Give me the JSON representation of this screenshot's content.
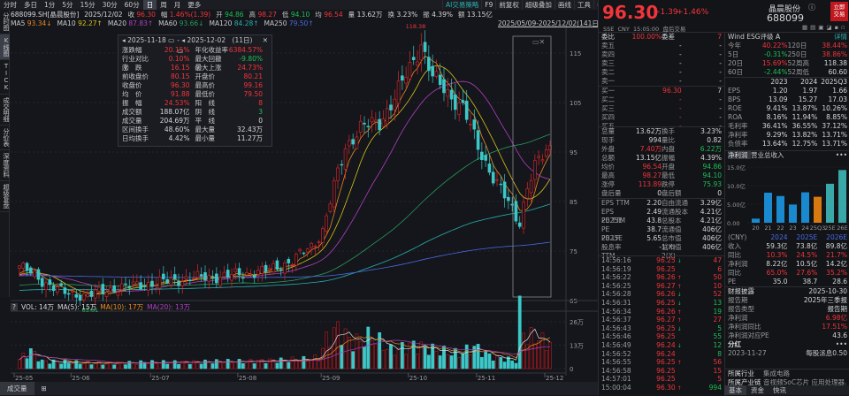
{
  "toolbar": {
    "tabs": [
      "分时",
      "多日",
      "1分",
      "5分",
      "15分",
      "30分",
      "60分",
      "日",
      "周",
      "月",
      "更多"
    ],
    "active": "日",
    "right": [
      "AI交易策略",
      "F9",
      "前复权",
      "超级叠加",
      "画线",
      "工具",
      "⚙",
      "?",
      "»"
    ]
  },
  "sidebar": [
    "分时图",
    "K线图",
    "TICK",
    "成交明细",
    "分价表",
    "深度资料",
    "超级复盘"
  ],
  "sidebar_active": "K线图",
  "info": {
    "code": "688099.SH[晶晨股份]",
    "date": "2025/12/02",
    "close_l": "收",
    "close": "96.30",
    "chg_l": "幅",
    "chg": "1.46%(1.39)",
    "open_l": "开",
    "open": "94.86",
    "high_l": "高",
    "high": "98.27",
    "low_l": "低",
    "low": "94.10",
    "avg_l": "均",
    "avg": "96.54",
    "vol_l": "量",
    "vol": "13.62万",
    "turn_l": "换",
    "turn": "3.23%",
    "amp_l": "振",
    "amp": "4.39%",
    "amt_l": "额",
    "amt": "13.15亿"
  },
  "ma": {
    "ma5": "MA5",
    "ma5v": "93.34↓",
    "ma10": "MA10",
    "ma10v": "92.27↑",
    "ma20": "MA20",
    "ma20v": "87.83↑",
    "ma60": "MA60",
    "ma60v": "93.66↓",
    "ma120": "MA120",
    "ma120v": "84.28↑",
    "ma250": "MA250",
    "ma250v": "79.50↑"
  },
  "range_label": "2025/05/09-2025/12/02(141日)",
  "popup": {
    "from": "2025-11-18",
    "to": "2025-12-02",
    "days": "(11日)",
    "rows": [
      [
        "涨跌幅",
        "20.15%",
        "r",
        "年化收益率",
        "6384.57%",
        "r"
      ],
      [
        "行业对比 ⓘ",
        "0.10%",
        "r",
        "最大回撤 ⓘ",
        "-9.80%",
        "g"
      ],
      [
        "涨　跌",
        "16.15",
        "r",
        "最大上涨",
        "24.73%",
        "r"
      ],
      [
        "前收盘价",
        "80.15",
        "r",
        "开盘价",
        "80.21",
        "r"
      ],
      [
        "收盘价",
        "96.30",
        "r",
        "最高价",
        "99.16",
        "r"
      ],
      [
        "均　价",
        "91.88",
        "r",
        "最低价",
        "79.50",
        "r"
      ],
      [
        "振　幅",
        "24.53%",
        "r",
        "阳　线",
        "8",
        "r"
      ],
      [
        "成交额",
        "188.07亿",
        "w",
        "阴　线",
        "3",
        "g"
      ],
      [
        "成交量",
        "204.69万",
        "w",
        "平　线",
        "0",
        "w"
      ],
      [
        "区间换手",
        "48.60%",
        "w",
        "最大量",
        "32.43万",
        "w"
      ],
      [
        "日均换手",
        "4.42%",
        "w",
        "最小量",
        "11.27万",
        "w"
      ]
    ]
  },
  "chart_data": {
    "type": "candlestick",
    "days": 141,
    "yticks": [
      "115",
      "105",
      "95",
      "85",
      "75",
      "65"
    ],
    "xticks": [
      "25-05",
      "25-06",
      "25-07",
      "25-08",
      "25-09",
      "25-10",
      "25-11",
      "25-12"
    ],
    "max_label": "118.38",
    "min_label": "65.61",
    "close_anchors": [
      [
        0,
        72
      ],
      [
        6,
        69
      ],
      [
        12,
        66.5
      ],
      [
        18,
        66
      ],
      [
        25,
        67.5
      ],
      [
        35,
        68.5
      ],
      [
        45,
        69.5
      ],
      [
        55,
        70
      ],
      [
        65,
        71
      ],
      [
        72,
        73
      ],
      [
        77,
        76
      ],
      [
        80,
        79
      ],
      [
        83,
        88
      ],
      [
        86,
        96
      ],
      [
        90,
        100
      ],
      [
        95,
        101
      ],
      [
        99,
        106
      ],
      [
        103,
        112
      ],
      [
        106,
        117
      ],
      [
        109,
        110
      ],
      [
        113,
        107
      ],
      [
        117,
        104
      ],
      [
        121,
        96
      ],
      [
        125,
        90
      ],
      [
        128,
        86
      ],
      [
        131,
        82
      ],
      [
        132,
        81
      ],
      [
        134,
        88
      ],
      [
        136,
        92
      ],
      [
        138,
        94
      ],
      [
        140,
        96.3
      ]
    ],
    "volume_anchors": [
      [
        0,
        5
      ],
      [
        3,
        10
      ],
      [
        6,
        4
      ],
      [
        20,
        3
      ],
      [
        40,
        3.5
      ],
      [
        60,
        4
      ],
      [
        75,
        5
      ],
      [
        79,
        6
      ],
      [
        81,
        16
      ],
      [
        84,
        22
      ],
      [
        88,
        14
      ],
      [
        93,
        18
      ],
      [
        98,
        10
      ],
      [
        104,
        13
      ],
      [
        110,
        10
      ],
      [
        116,
        8
      ],
      [
        120,
        12
      ],
      [
        124,
        7
      ],
      [
        129,
        5
      ],
      [
        131,
        4
      ],
      [
        132,
        30
      ],
      [
        134,
        16
      ],
      [
        136,
        18
      ],
      [
        138,
        15
      ],
      [
        140,
        14
      ]
    ],
    "vol_yticks": [
      "26万",
      "13万",
      "0"
    ]
  },
  "vol": {
    "help": "?",
    "vol": "VOL: 14万",
    "ma5": "MA(5): 15万",
    "ma10": "MA(10): 17万",
    "ma20": "MA(20): 13万"
  },
  "bottom_tabs": [
    "成交量",
    "⊞"
  ],
  "quote": {
    "price": "96.30",
    "chg": "+1.39",
    "pct": "+1.46%",
    "name": "晶晨股份",
    "code": "688099",
    "trade_btn": "立即\n交易",
    "meta": "SSE  CNY  15:05:00  盘后交易"
  },
  "book": {
    "ratio_l": "委比",
    "ratio": "100.00%",
    "diff_l": "委差",
    "diff": "7",
    "asks": [
      [
        "卖五",
        "-",
        "-"
      ],
      [
        "卖四",
        "-",
        "-"
      ],
      [
        "卖三",
        "-",
        "-"
      ],
      [
        "卖二",
        "-",
        "-"
      ],
      [
        "卖一",
        "-",
        "-"
      ]
    ],
    "bids": [
      [
        "买一",
        "96.30",
        "7"
      ],
      [
        "买二",
        "-",
        "-"
      ],
      [
        "买三",
        "-",
        "-"
      ],
      [
        "买四",
        "-",
        "-"
      ],
      [
        "买五",
        "-",
        "-"
      ]
    ]
  },
  "stats": [
    [
      "总量",
      "13.62万",
      "w",
      "换手",
      "3.23%",
      "w"
    ],
    [
      "现手",
      "994",
      "w",
      "量比",
      "0.82",
      "w"
    ],
    [
      "外盘",
      "7.40万",
      "r",
      "内盘",
      "6.22万",
      "g"
    ],
    [
      "总额",
      "13.15亿",
      "w",
      "振幅",
      "4.39%",
      "w"
    ],
    [
      "均价",
      "96.54",
      "r",
      "开盘",
      "94.86",
      "g"
    ],
    [
      "最高",
      "98.27",
      "r",
      "最低",
      "94.10",
      "g"
    ],
    [
      "涨停",
      "113.89",
      "r",
      "跌停",
      "75.93",
      "g"
    ],
    [
      "盘后量",
      "0",
      "w",
      "盘后额",
      "0",
      "w"
    ]
  ],
  "valuation": [
    [
      "EPS TTM",
      "2.20",
      "自由流通",
      "3.29亿"
    ],
    [
      "EPS 2025E",
      "2.49",
      "流通股本",
      "4.21亿"
    ],
    [
      "PE TTM",
      "43.8",
      "总股本",
      "4.21亿"
    ],
    [
      "PE 2025E",
      "38.7",
      "流通值",
      "406亿"
    ],
    [
      "PB LF",
      "5.65",
      "总市值1(X)",
      "406亿"
    ],
    [
      "股息率TTM",
      "-",
      "总市值2(X)",
      "406亿"
    ]
  ],
  "ticks": [
    [
      "14:56:16",
      "96.25",
      "↓",
      "47",
      "r"
    ],
    [
      "14:56:19",
      "96.25",
      "",
      "6",
      "r"
    ],
    [
      "14:56:22",
      "96.26",
      "↑",
      "50",
      "r"
    ],
    [
      "14:56:25",
      "96.27",
      "↑",
      "10",
      "r"
    ],
    [
      "14:56:28",
      "96.26",
      "↓",
      "52",
      "r"
    ],
    [
      "14:56:31",
      "96.25",
      "↓",
      "13",
      "g"
    ],
    [
      "14:56:34",
      "96.26",
      "↑",
      "19",
      "g"
    ],
    [
      "14:56:37",
      "96.27",
      "↑",
      "27",
      "r"
    ],
    [
      "14:56:43",
      "96.25",
      "↓",
      "5",
      "g"
    ],
    [
      "14:56:46",
      "96.25",
      "",
      "55",
      "g"
    ],
    [
      "14:56:49",
      "96.24",
      "↓",
      "12",
      "g"
    ],
    [
      "14:56:52",
      "96.24",
      "",
      "8",
      "g"
    ],
    [
      "14:56:55",
      "96.25",
      "↑",
      "56",
      "r"
    ],
    [
      "14:56:58",
      "96.25",
      "",
      "15",
      "r"
    ],
    [
      "14:57:01",
      "96.25",
      "",
      "5",
      "r"
    ],
    [
      "15:00:04",
      "96.30",
      "↑",
      "994",
      "g"
    ]
  ],
  "esg": {
    "label": "Wind ESG评级",
    "grade": "A",
    "detail": "详情"
  },
  "perf": [
    [
      "今年",
      "40.22%",
      "r",
      "120日",
      "38.44%",
      "r"
    ],
    [
      "5日",
      "-0.31%",
      "g",
      "250日",
      "38.86%",
      "r"
    ],
    [
      "20日",
      "15.69%",
      "r",
      "52周高",
      "118.38",
      "w"
    ],
    [
      "60日",
      "-2.44%",
      "g",
      "52周低",
      "60.60",
      "w"
    ]
  ],
  "fin": {
    "headers": [
      "",
      "2023",
      "2024",
      "2025Q3"
    ],
    "rows": [
      [
        "EPS",
        "1.20",
        "1.97",
        "1.66"
      ],
      [
        "BPS",
        "13.09",
        "15.27",
        "17.03"
      ],
      [
        "ROE",
        "9.41%",
        "13.87%",
        "10.26%"
      ],
      [
        "ROA",
        "8.16%",
        "11.94%",
        "8.85%"
      ],
      [
        "毛利率",
        "36.41%",
        "36.55%",
        "37.12%"
      ],
      [
        "净利率",
        "9.29%",
        "13.82%",
        "13.71%"
      ],
      [
        "负债率",
        "13.64%",
        "12.75%",
        "13.71%"
      ]
    ]
  },
  "profit_tabs": [
    "净利润",
    "营业总收入",
    "•••"
  ],
  "profit_chart": {
    "type": "bar",
    "categories": [
      "20",
      "21",
      "22",
      "23",
      "24",
      "25Q3",
      "25E",
      "26E"
    ],
    "values": [
      1.1,
      8.1,
      7.2,
      4.9,
      8.2,
      7.0,
      10.5,
      14.2
    ],
    "yticks": [
      "15.0亿",
      "10.0亿",
      "5.00亿",
      "0.00"
    ],
    "colors": [
      "#1a8ad0",
      "#1a8ad0",
      "#1a8ad0",
      "#1a8ad0",
      "#1a8ad0",
      "#d87a10",
      "#3aa8a8",
      "#3aa8a8"
    ]
  },
  "forecast": {
    "headers": [
      "(CNY)",
      "2024",
      "2025E",
      "2026E"
    ],
    "rows": [
      [
        "收入",
        "59.3亿",
        "73.8亿",
        "89.8亿",
        "w"
      ],
      [
        "同比",
        "10.3%",
        "24.5%",
        "21.7%",
        "r"
      ],
      [
        "净利润",
        "8.22亿",
        "10.5亿",
        "14.2亿",
        "w"
      ],
      [
        "同比",
        "65.0%",
        "27.6%",
        "35.2%",
        "r"
      ],
      [
        "PE",
        "35.0",
        "38.7",
        "28.6",
        "w"
      ]
    ]
  },
  "report": {
    "title": "财报披露",
    "date": "2025-10-30",
    "rows": [
      [
        "报告期",
        "2025年三季报",
        "w"
      ],
      [
        "报告类型",
        "报告期",
        "w"
      ],
      [
        "净利润",
        "6.98亿",
        "r"
      ],
      [
        "净利润同比",
        "17.51%",
        "r"
      ],
      [
        "净利润对应PE",
        "43.6",
        "w"
      ]
    ]
  },
  "dividend": {
    "title": "分红",
    "more": "•••",
    "date": "2023-11-27",
    "text": "每股派息0.50"
  },
  "industry": [
    [
      "所属行业",
      "集成电路"
    ],
    [
      "所属产业链",
      "音视频SoC芯片  应用处理器..."
    ],
    [
      "主营业务",
      "半导体集成电路芯片的生产和..."
    ]
  ],
  "right_tabs": [
    "基本",
    "资金",
    "快讯"
  ]
}
